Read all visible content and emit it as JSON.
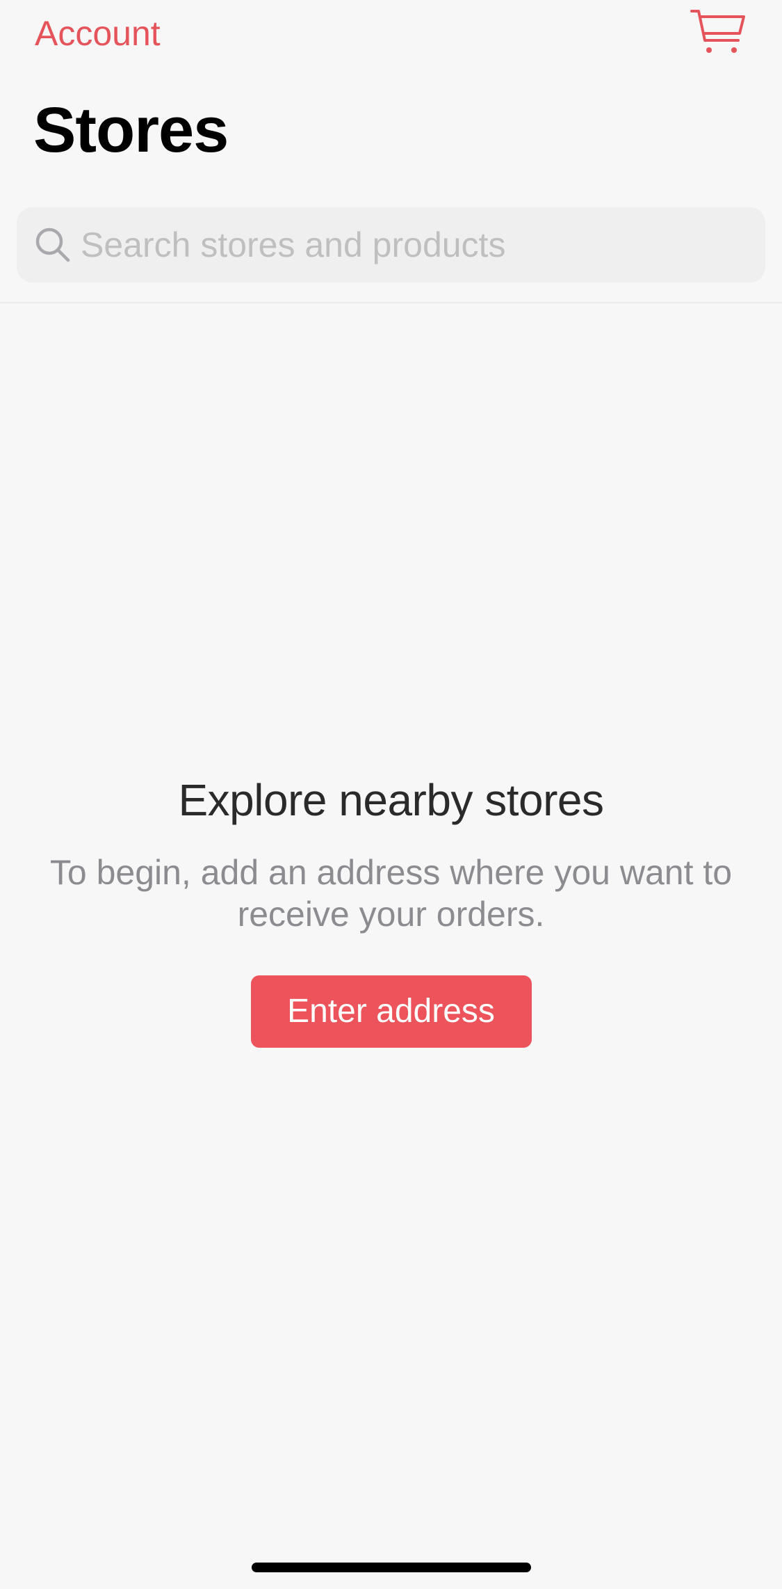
{
  "header": {
    "account_label": "Account",
    "cart_icon": "cart-icon",
    "title": "Stores"
  },
  "search": {
    "placeholder": "Search stores and products",
    "value": "",
    "icon": "search-icon"
  },
  "empty_state": {
    "title": "Explore nearby stores",
    "description": "To begin, add an address where you want to receive your orders.",
    "button_label": "Enter address"
  },
  "colors": {
    "accent": "#e5545b",
    "button": "#ec535a",
    "background": "#f7f7f7",
    "search_bg": "#efefef",
    "muted_text": "#8b8b90"
  }
}
